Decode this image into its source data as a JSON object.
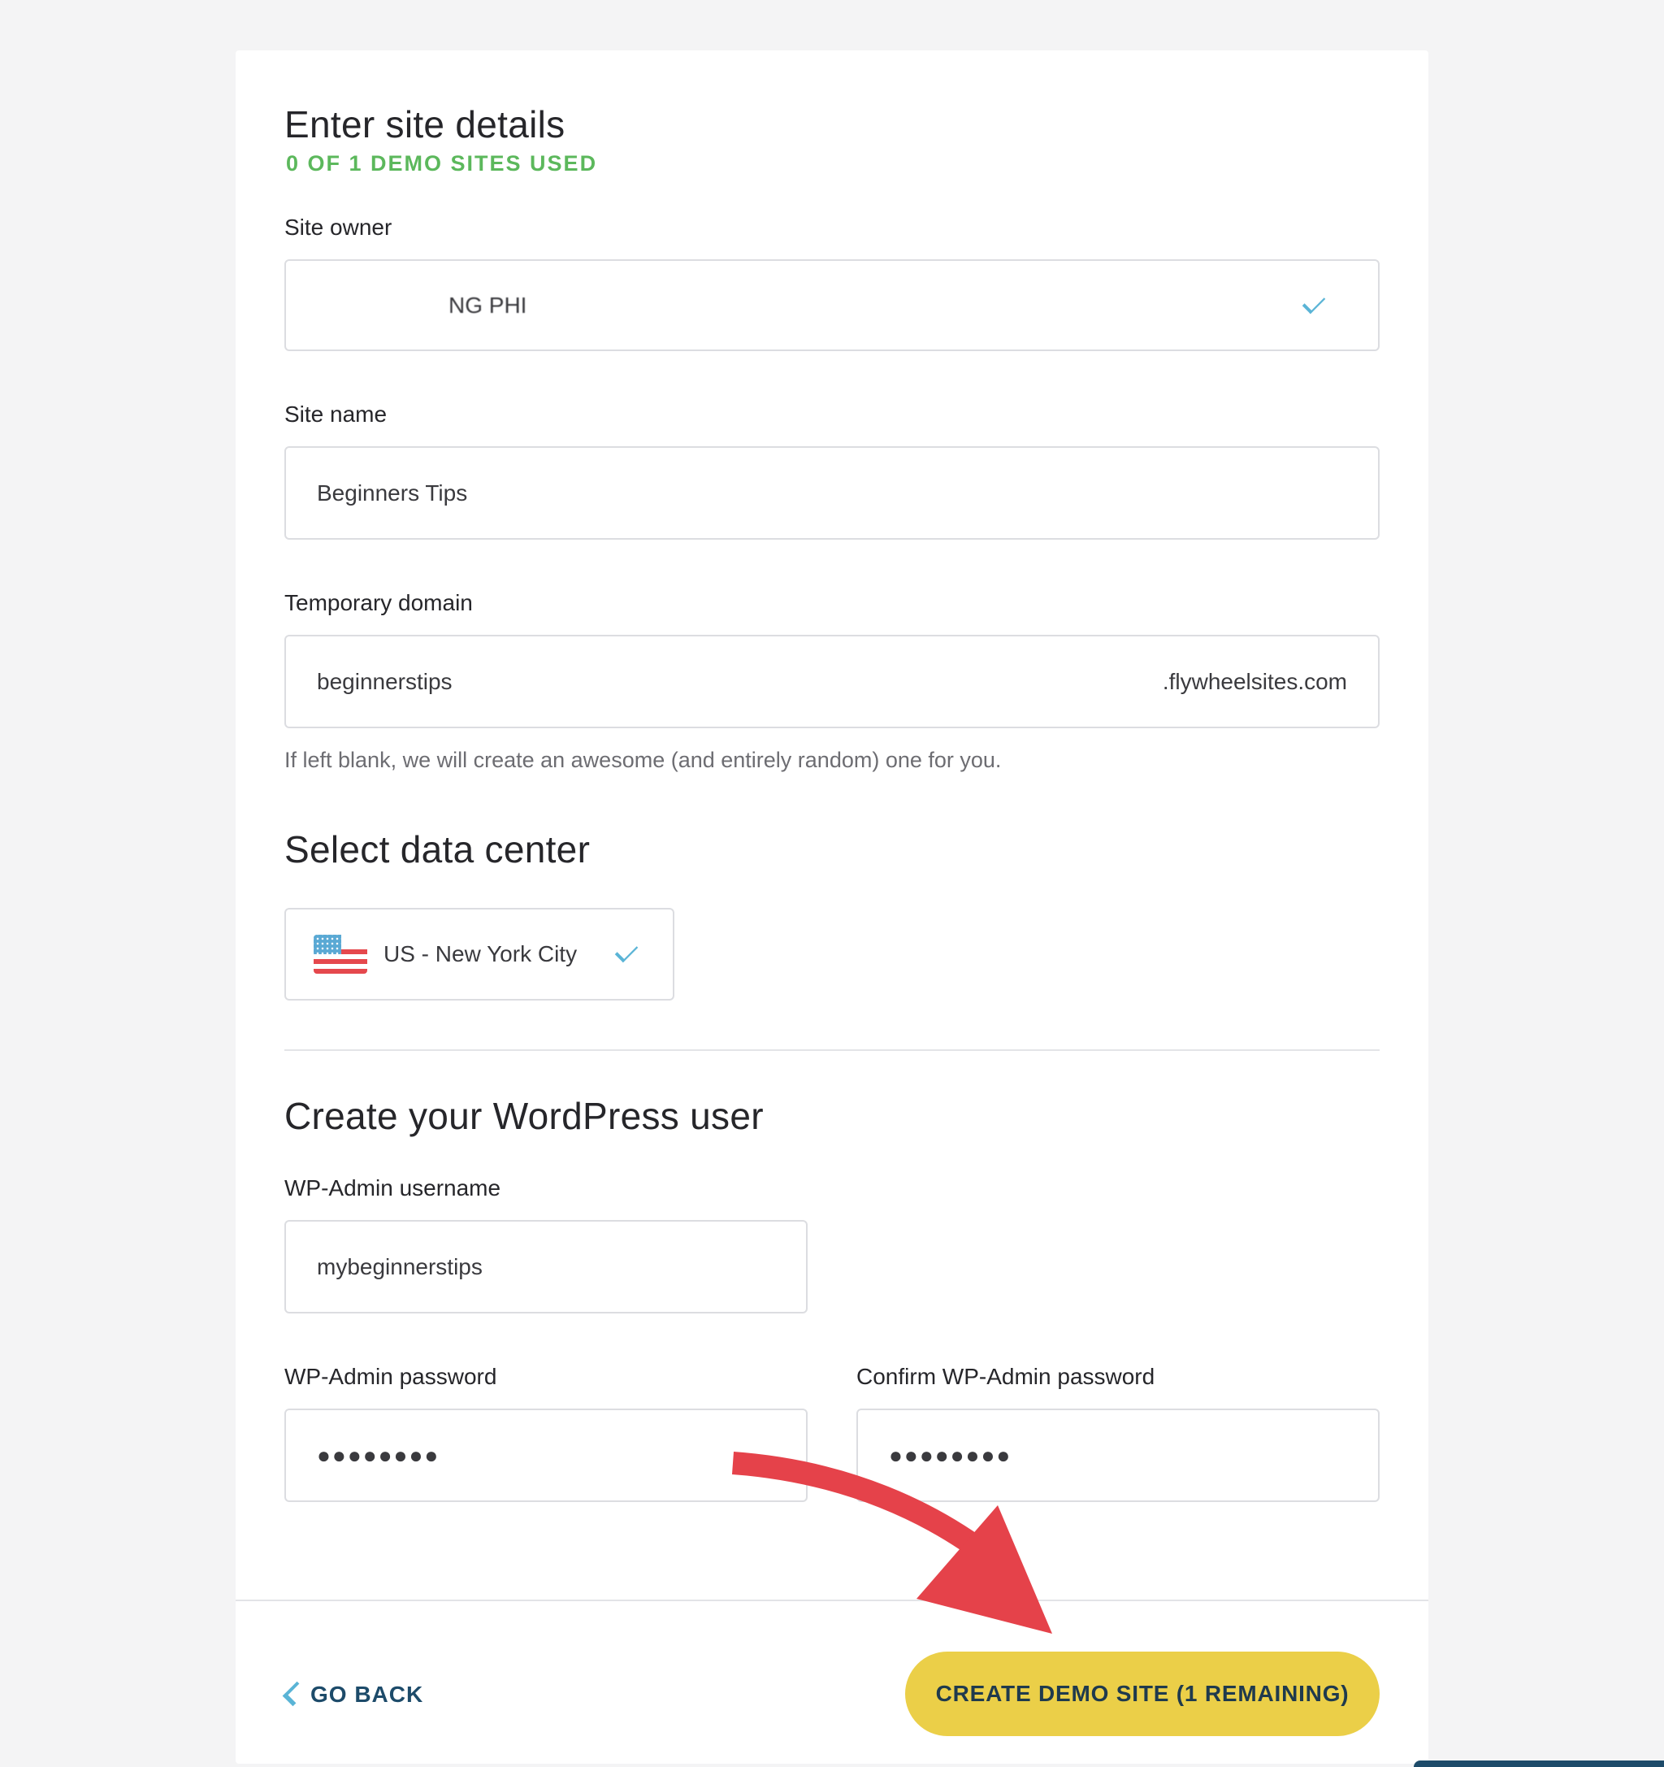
{
  "header": {
    "title": "Enter site details",
    "subtitle": "0 OF 1 DEMO SITES USED"
  },
  "site_owner": {
    "label": "Site owner",
    "value": "NG PHI"
  },
  "site_name": {
    "label": "Site name",
    "value": "Beginners Tips"
  },
  "temporary_domain": {
    "label": "Temporary domain",
    "value": "beginnerstips",
    "suffix": ".flywheelsites.com",
    "hint": "If left blank, we will create an awesome (and entirely random) one for you."
  },
  "data_center": {
    "heading": "Select data center",
    "selected": "US - New York City",
    "flag_icon": "us-flag-icon"
  },
  "wordpress_user": {
    "heading": "Create your WordPress user",
    "username_label": "WP-Admin username",
    "username_value": "mybeginnerstips",
    "password_label": "WP-Admin password",
    "password_value": "●●●●●●●●",
    "confirm_label": "Confirm WP-Admin password",
    "confirm_value": "●●●●●●●●"
  },
  "footer": {
    "back_label": "GO BACK",
    "create_label": "CREATE DEMO SITE (1 REMAINING)"
  },
  "colors": {
    "accent_green": "#5cb85c",
    "accent_blue": "#5ab4d6",
    "button_yellow": "#ebcf48",
    "annotation_arrow": "#e5424a"
  }
}
